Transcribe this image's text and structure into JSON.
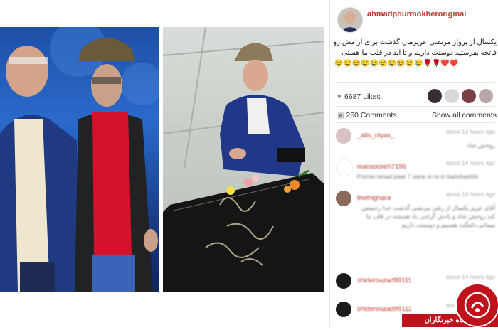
{
  "post": {
    "username": "ahmadpourmokheroriginal",
    "caption_lines": [
      "یکسال از پرواز مرتضی عزیزمان گذشت برای آرامش روحش",
      "فاتحه بفرستید دوستت داریم و تا ابد در قلب ما هستی",
      "😢😢😢😢😢😢😢😢😢😢🌹🌹❤️❤️"
    ],
    "likes": "6687 Likes",
    "comments_count": "250 Comments",
    "show_all": "Show all comments"
  },
  "comments": [
    {
      "name": "_alis_niyas_",
      "time": "about 14 hours ago",
      "text": "روحش شاد"
    },
    {
      "name": "mansooreh7196",
      "time": "about 14 hours ago",
      "text": "Porran omad paar 7 sane in ra in bahshashhi"
    },
    {
      "name": "thelhighara",
      "time": "about 14 hours ago",
      "text": "آقای عزیز یکسال از رفتن مرتضی گذشت خدا رحمتش کند روحش شاد و یادش گرامی باد همیشه در قلب ما میمانی دلتنگت هستیم و دوستت داریم"
    },
    {
      "name": "shiderouzad99111",
      "time": "about 14 hours ago",
      "text": "روحش شاد"
    },
    {
      "name": "shiderouzad99111",
      "time": "about 14 hours ago",
      "text": "روحش شاد یادش گرامی"
    }
  ],
  "badge": {
    "text": "باشگاه خبرنگاران"
  },
  "colors": {
    "accent": "#c0392b",
    "badge": "#c0121b"
  }
}
